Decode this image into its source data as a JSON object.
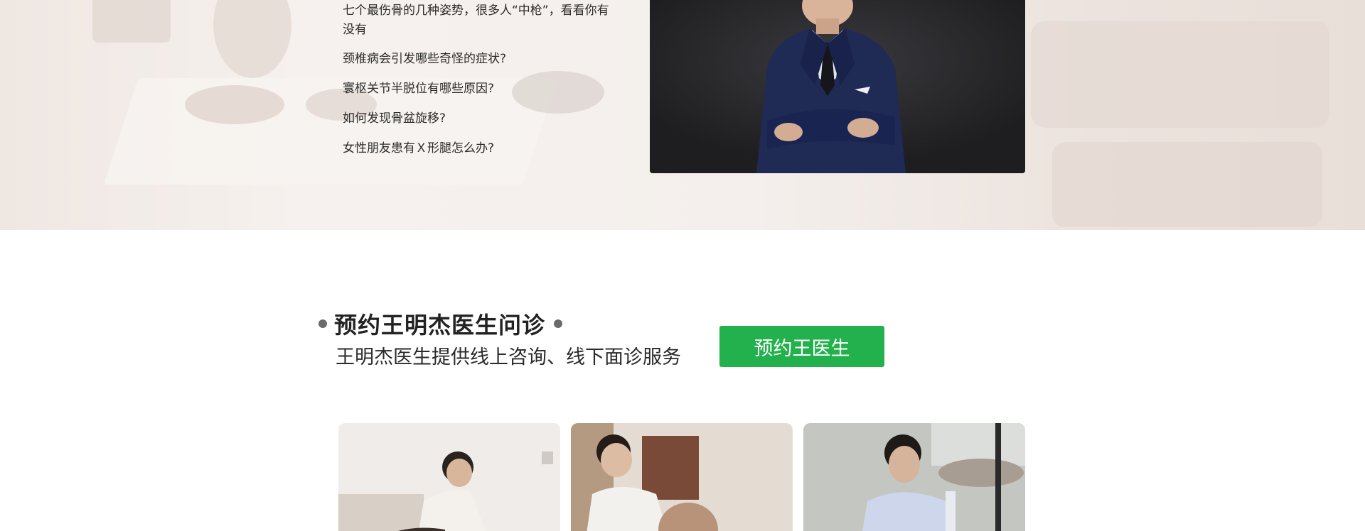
{
  "articles": [
    "七个最伤骨的几种姿势，很多人“中枪”，看看你有没有",
    "颈椎病会引发哪些奇怪的症状?",
    "寰枢关节半脱位有哪些原因?",
    "如何发现骨盆旋移?",
    "女性朋友患有Ｘ形腿怎么办?"
  ],
  "booking": {
    "title": "预约王明杰医生问诊",
    "subtitle": "王明杰医生提供线上咨询、线下面诊服务",
    "button_label": "预约王医生"
  },
  "colors": {
    "button": "#22b14c",
    "dot": "#6a6a6a",
    "text": "#222222"
  }
}
